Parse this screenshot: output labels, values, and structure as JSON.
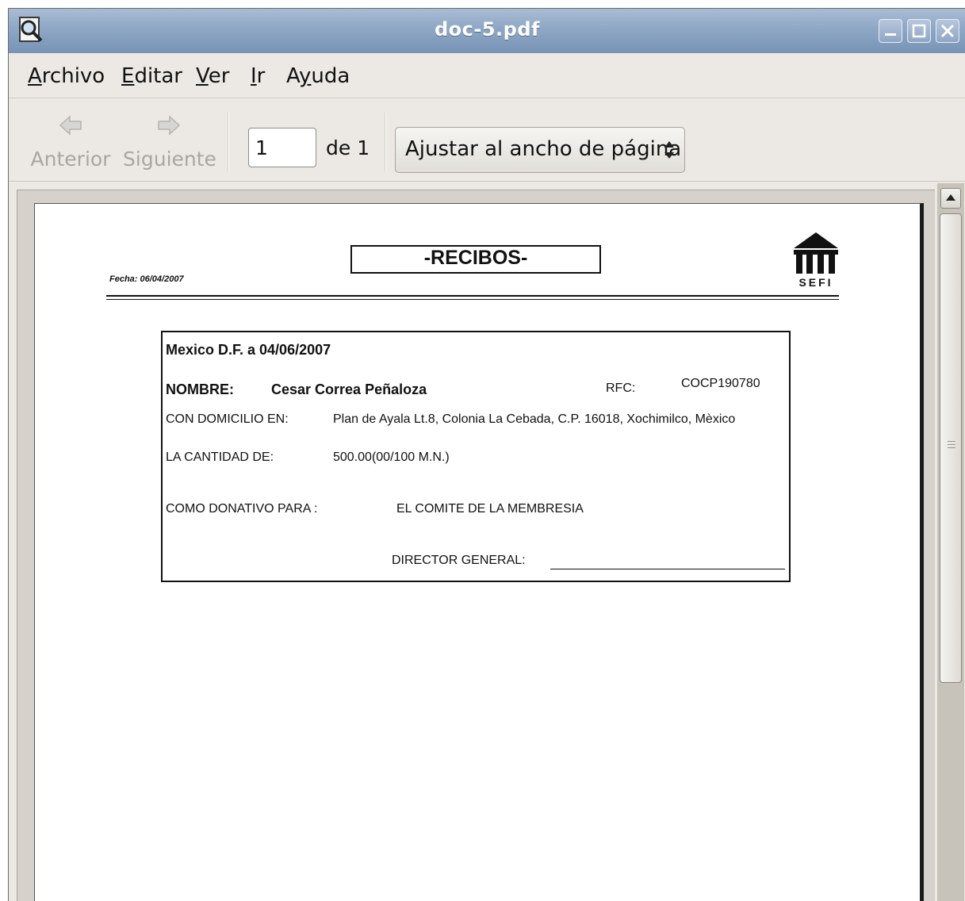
{
  "window": {
    "title": "doc-5.pdf"
  },
  "menubar": {
    "items": [
      {
        "underline": "A",
        "rest": "rchivo"
      },
      {
        "underline": "E",
        "rest": "ditar"
      },
      {
        "underline": "V",
        "rest": "er"
      },
      {
        "underline": "I",
        "rest": "r"
      },
      {
        "pre": "A",
        "underline": "y",
        "rest": "uda"
      }
    ]
  },
  "toolbar": {
    "prev_label": "Anterior",
    "next_label": "Siguiente",
    "page_value": "1",
    "page_of": "de 1",
    "zoom_selected": "Ajustar al ancho de página"
  },
  "document": {
    "fecha": "Fecha: 06/04/2007",
    "title": "-RECIBOS-",
    "logo_text": "SEFI",
    "receipt": {
      "place_date": "Mexico D.F. a  04/06/2007",
      "nombre_label": "NOMBRE:",
      "nombre_value": "Cesar Correa Peñaloza",
      "rfc_label": "RFC:",
      "rfc_value": "COCP190780",
      "domicilio_label": "CON DOMICILIO EN:",
      "domicilio_value": "Plan de Ayala Lt.8, Colonia La Cebada, C.P. 16018, Xochimilco, Mèxico",
      "cantidad_label": "LA CANTIDAD DE:",
      "cantidad_value": "500.00(00/100 M.N.)",
      "donativo_label": "COMO DONATIVO PARA :",
      "donativo_value": "EL COMITE DE LA MEMBRESIA",
      "director_label": "DIRECTOR GENERAL:"
    }
  }
}
